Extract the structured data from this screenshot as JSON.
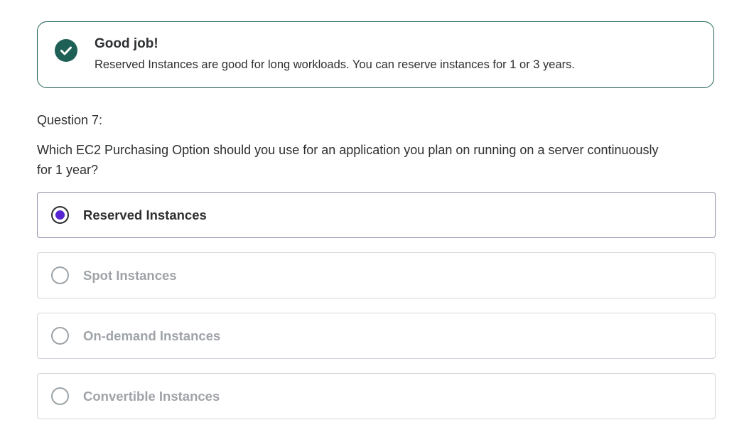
{
  "feedback": {
    "icon": "check-circle-icon",
    "title": "Good job!",
    "message": "Reserved Instances are good for long workloads. You can reserve instances for 1 or 3 years.",
    "accent_color": "#1e6055"
  },
  "question": {
    "number_label": "Question 7:",
    "text": "Which EC2 Purchasing Option should you use for an application you plan on running on a server continuously for 1 year?"
  },
  "options": [
    {
      "label": "Reserved Instances",
      "selected": true
    },
    {
      "label": "Spot Instances",
      "selected": false
    },
    {
      "label": "On-demand Instances",
      "selected": false
    },
    {
      "label": "Convertible Instances",
      "selected": false
    }
  ],
  "colors": {
    "selected_radio": "#5624d0",
    "text": "#2d2f31",
    "muted_text": "#9fa3a8"
  }
}
